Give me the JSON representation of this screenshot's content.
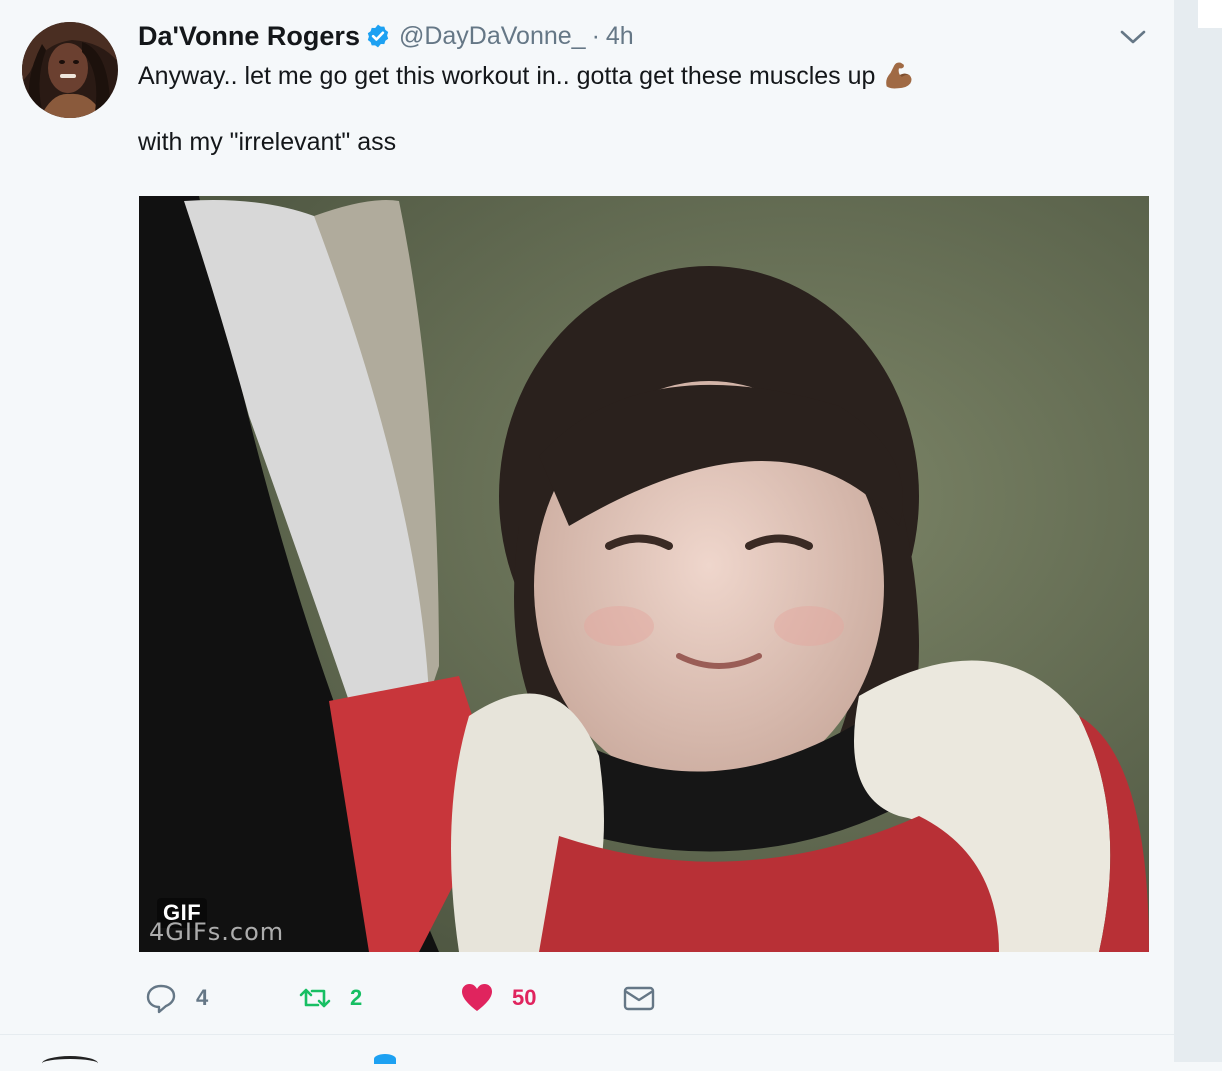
{
  "tweet": {
    "author_name": "Da'Vonne Rogers",
    "handle": "@DayDaVonne_",
    "separator": "·",
    "time": "4h",
    "text_line1": "Anyway.. let me go get this workout in.. gotta get these muscles up",
    "text_line2": "with my \"irrelevant\" ass",
    "emoji": "flexed-biceps-emoji",
    "media": {
      "badge": "GIF",
      "watermark": "4GIFs.com"
    },
    "actions": {
      "reply_count": "4",
      "retweet_count": "2",
      "like_count": "50"
    }
  },
  "colors": {
    "background": "#f5f8fa",
    "text": "#14171a",
    "secondary": "#657786",
    "verified": "#1da1f2",
    "retweet": "#17bf63",
    "like": "#e0245e"
  },
  "icons": [
    "verified-badge-icon",
    "chevron-down-icon",
    "reply-icon",
    "retweet-icon",
    "heart-icon",
    "envelope-icon"
  ]
}
